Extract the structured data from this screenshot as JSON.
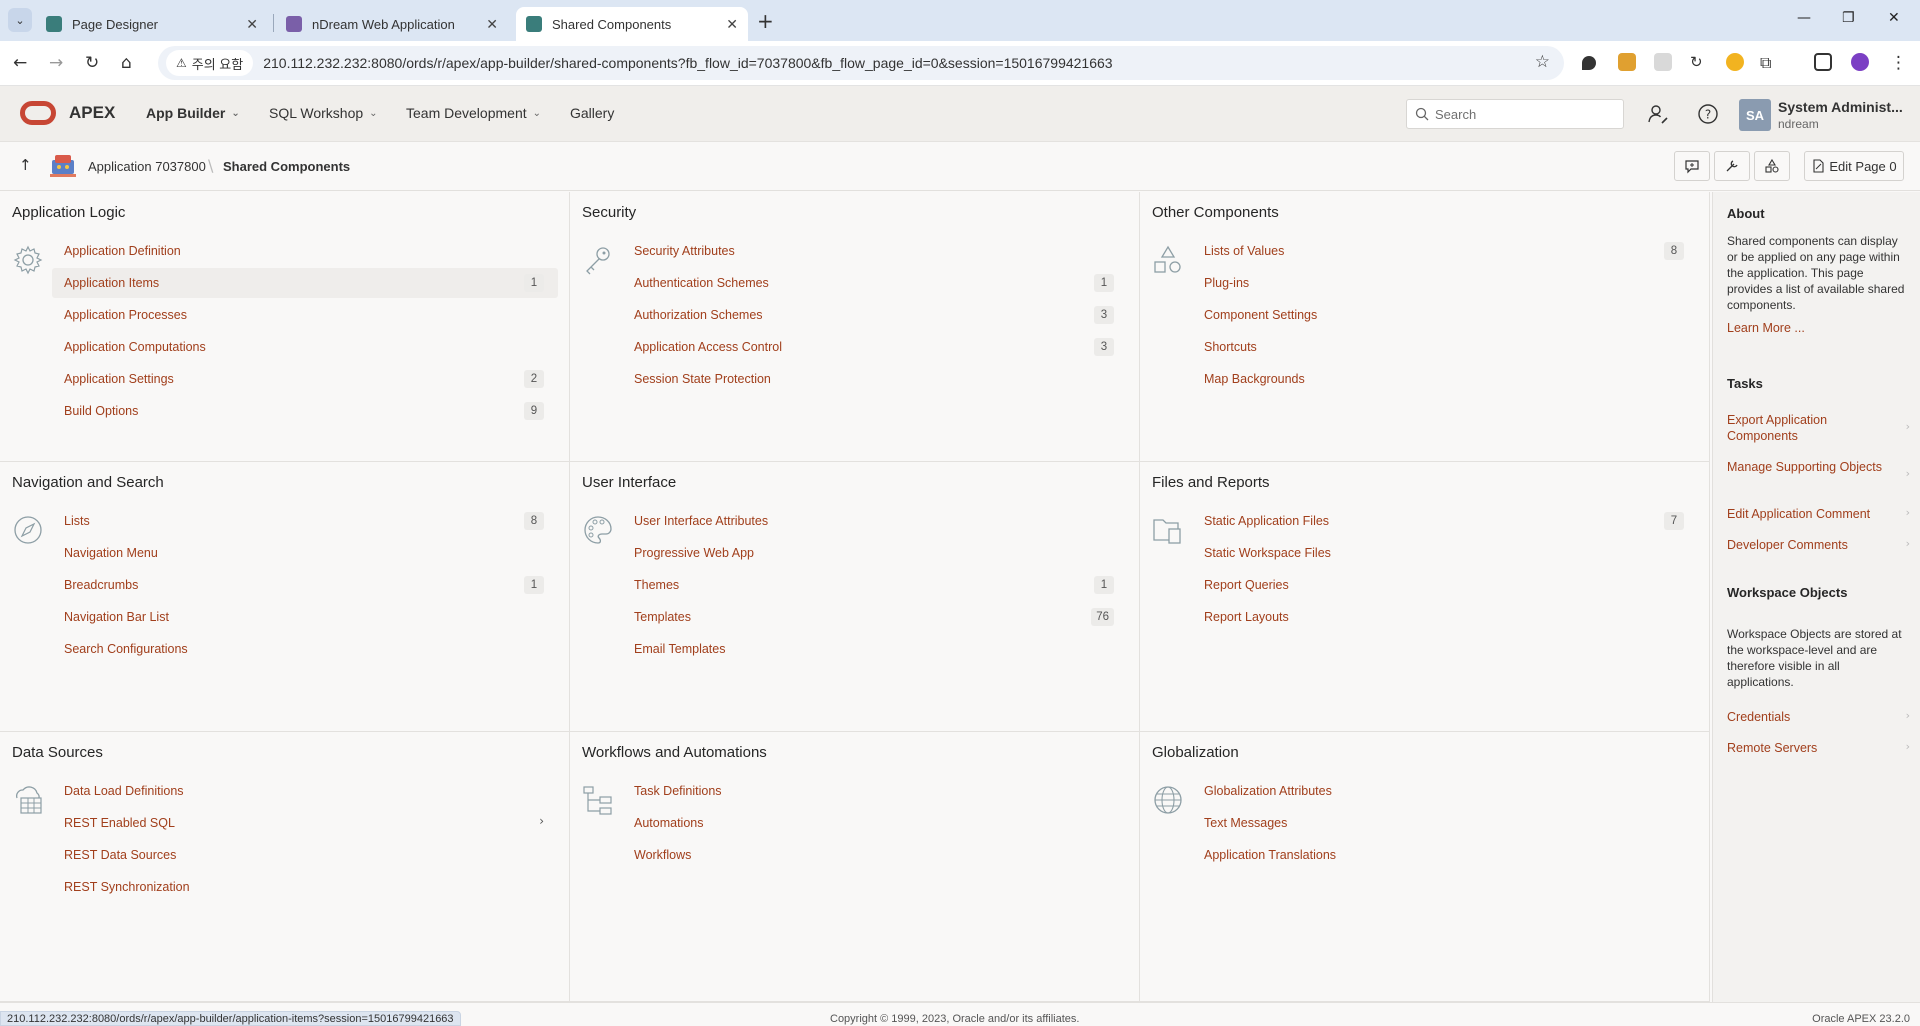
{
  "browser": {
    "tabs": [
      {
        "title": "Page Designer"
      },
      {
        "title": "nDream Web Application"
      },
      {
        "title": "Shared Components"
      }
    ],
    "security_warning": "주의 요함",
    "url": "210.112.232.232:8080/ords/r/apex/app-builder/shared-components?fb_flow_id=7037800&fb_flow_page_id=0&session=15016799421663"
  },
  "header": {
    "brand": "APEX",
    "nav": [
      {
        "label": "App Builder"
      },
      {
        "label": "SQL Workshop"
      },
      {
        "label": "Team Development"
      },
      {
        "label": "Gallery"
      }
    ],
    "search_placeholder": "Search",
    "user": {
      "initials": "SA",
      "name": "System Administ...",
      "workspace": "ndream"
    }
  },
  "breadcrumb": {
    "application": "Application 7037800",
    "current": "Shared Components",
    "edit_page_label": "Edit Page 0"
  },
  "panels": [
    {
      "title": "Application Logic",
      "icon": "gear-icon",
      "items": [
        {
          "label": "Application Definition",
          "count": ""
        },
        {
          "label": "Application Items",
          "count": "1"
        },
        {
          "label": "Application Processes",
          "count": ""
        },
        {
          "label": "Application Computations",
          "count": ""
        },
        {
          "label": "Application Settings",
          "count": "2"
        },
        {
          "label": "Build Options",
          "count": "9"
        }
      ]
    },
    {
      "title": "Security",
      "icon": "key-icon",
      "items": [
        {
          "label": "Security Attributes",
          "count": ""
        },
        {
          "label": "Authentication Schemes",
          "count": "1"
        },
        {
          "label": "Authorization Schemes",
          "count": "3"
        },
        {
          "label": "Application Access Control",
          "count": "3"
        },
        {
          "label": "Session State Protection",
          "count": ""
        }
      ]
    },
    {
      "title": "Other Components",
      "icon": "shapes-icon",
      "items": [
        {
          "label": "Lists of Values",
          "count": "8"
        },
        {
          "label": "Plug-ins",
          "count": ""
        },
        {
          "label": "Component Settings",
          "count": ""
        },
        {
          "label": "Shortcuts",
          "count": ""
        },
        {
          "label": "Map Backgrounds",
          "count": ""
        }
      ]
    },
    {
      "title": "Navigation and Search",
      "icon": "compass-icon",
      "items": [
        {
          "label": "Lists",
          "count": "8"
        },
        {
          "label": "Navigation Menu",
          "count": ""
        },
        {
          "label": "Breadcrumbs",
          "count": "1"
        },
        {
          "label": "Navigation Bar List",
          "count": ""
        },
        {
          "label": "Search Configurations",
          "count": ""
        }
      ]
    },
    {
      "title": "User Interface",
      "icon": "palette-icon",
      "items": [
        {
          "label": "User Interface Attributes",
          "count": ""
        },
        {
          "label": "Progressive Web App",
          "count": ""
        },
        {
          "label": "Themes",
          "count": "1"
        },
        {
          "label": "Templates",
          "count": "76"
        },
        {
          "label": "Email Templates",
          "count": ""
        }
      ]
    },
    {
      "title": "Files and Reports",
      "icon": "folder-files-icon",
      "items": [
        {
          "label": "Static Application Files",
          "count": "7"
        },
        {
          "label": "Static Workspace Files",
          "count": ""
        },
        {
          "label": "Report Queries",
          "count": ""
        },
        {
          "label": "Report Layouts",
          "count": ""
        }
      ]
    },
    {
      "title": "Data Sources",
      "icon": "cloud-table-icon",
      "items": [
        {
          "label": "Data Load Definitions",
          "count": ""
        },
        {
          "label": "REST Enabled SQL",
          "count": ""
        },
        {
          "label": "REST Data Sources",
          "count": ""
        },
        {
          "label": "REST Synchronization",
          "count": ""
        }
      ]
    },
    {
      "title": "Workflows and Automations",
      "icon": "flow-icon",
      "items": [
        {
          "label": "Task Definitions",
          "count": ""
        },
        {
          "label": "Automations",
          "count": ""
        },
        {
          "label": "Workflows",
          "count": ""
        }
      ]
    },
    {
      "title": "Globalization",
      "icon": "globe-icon",
      "items": [
        {
          "label": "Globalization Attributes",
          "count": ""
        },
        {
          "label": "Text Messages",
          "count": ""
        },
        {
          "label": "Application Translations",
          "count": ""
        }
      ]
    }
  ],
  "sidebar": {
    "about_title": "About",
    "about_text": "Shared components can display or be applied on any page within the application. This page provides a list of available shared components.",
    "learn_more": "Learn More ...",
    "tasks_title": "Tasks",
    "tasks": [
      {
        "label": "Export Application Components"
      },
      {
        "label": "Manage Supporting Objects"
      },
      {
        "label": "Edit Application Comment"
      },
      {
        "label": "Developer Comments"
      }
    ],
    "workspace_title": "Workspace Objects",
    "workspace_text": "Workspace Objects are stored at the workspace-level and are therefore visible in all applications.",
    "workspace_links": [
      {
        "label": "Credentials"
      },
      {
        "label": "Remote Servers"
      }
    ]
  },
  "footer": {
    "status_url": "210.112.232.232:8080/ords/r/apex/app-builder/application-items?session=15016799421663",
    "copyright": "Copyright © 1999, 2023, Oracle and/or its affiliates.",
    "version": "Oracle APEX 23.2.0"
  },
  "colors": {
    "link": "#a13f1c",
    "brand": "#c74634"
  }
}
